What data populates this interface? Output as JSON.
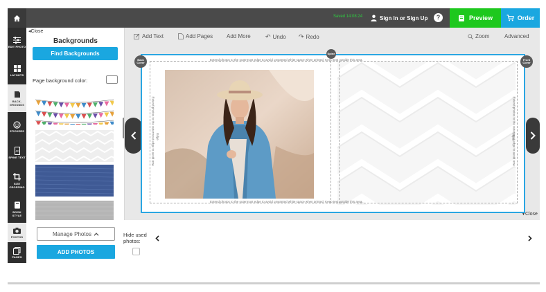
{
  "topbar": {
    "saved_status": "Saved 14:08:24",
    "signin_label": "Sign In or Sign Up",
    "help_label": "?",
    "preview_label": "Preview",
    "order_label": "Order"
  },
  "tools": [
    {
      "label": "EDIT PHOTO",
      "icon": "sliders-icon"
    },
    {
      "label": "LAYOUTS",
      "icon": "grid-icon"
    },
    {
      "label": "BACK-GROUNDS",
      "icon": "backgrounds-icon"
    },
    {
      "label": "STICKERS",
      "icon": "smiley-icon"
    },
    {
      "label": "SPINE TEXT",
      "icon": "spine-text-icon"
    },
    {
      "label": "SIZE CROPPING",
      "icon": "crop-icon"
    },
    {
      "label": "BOOK STYLE",
      "icon": "book-icon"
    },
    {
      "label": "PHOTOS",
      "icon": "camera-icon"
    },
    {
      "label": "PAGES",
      "icon": "pages-icon"
    }
  ],
  "panel": {
    "close_label": "Close",
    "title": "Backgrounds",
    "find_button": "Find Backgrounds",
    "page_bg_label": "Page background color:"
  },
  "editor_toolbar": {
    "add_text": "Add Text",
    "add_pages": "Add Pages",
    "add_more": "Add More",
    "undo": "Undo",
    "redo": "Redo",
    "zoom": "Zoom",
    "advanced": "Advanced"
  },
  "canvas": {
    "back_cover": "Back Cover",
    "spine": "Spine",
    "front_cover": "Front Cover",
    "safety_text": "Extend photos to the outermost edge to avoid unwanted white space when printed. Keep text outside this area.",
    "side_label": "Edge",
    "close_label": "Close"
  },
  "bottom": {
    "manage_photos": "Manage Photos",
    "add_photos": "ADD PHOTOS",
    "hide_used_line1": "Hide used",
    "hide_used_line2": "photos:"
  },
  "colors": {
    "accent_blue": "#1aa7e0",
    "preview_green": "#1ec81e",
    "topbar": "#4a4a4a",
    "toolstrip": "#2e2e2e"
  }
}
